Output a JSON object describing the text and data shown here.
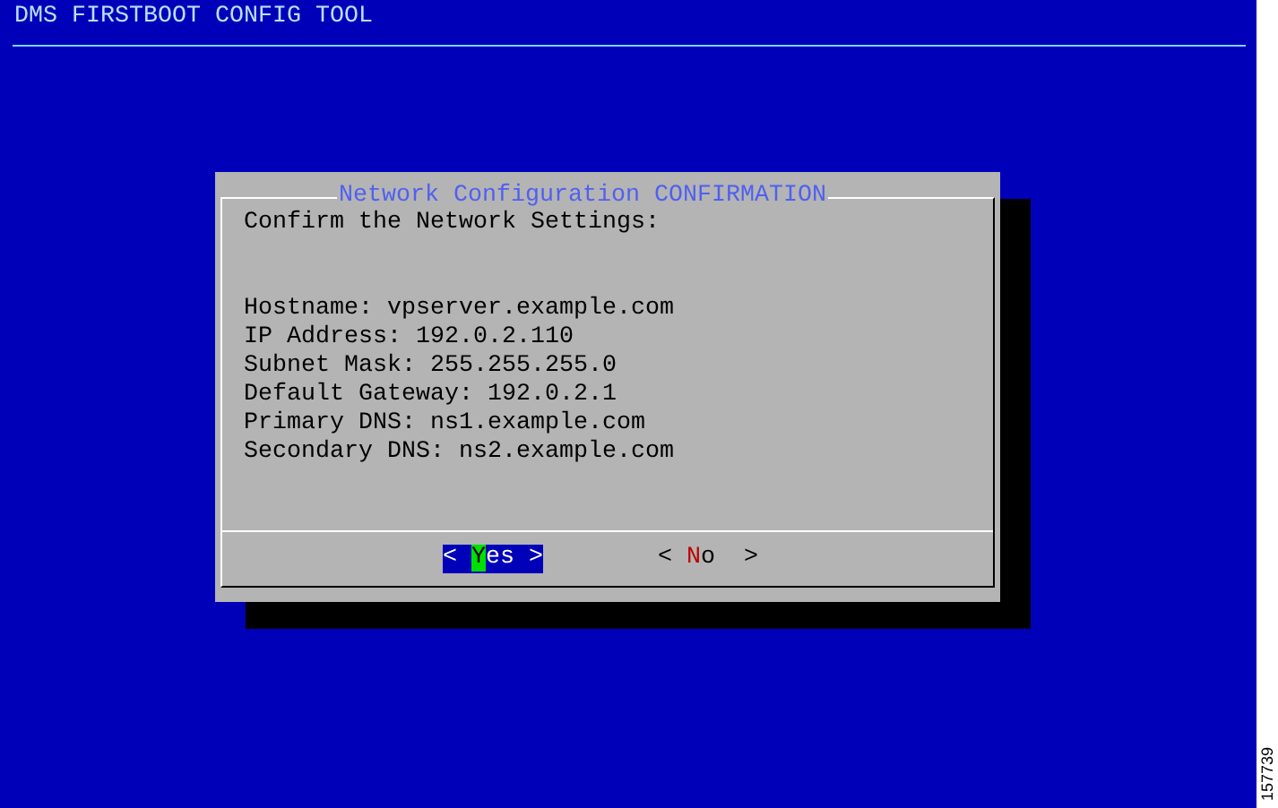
{
  "screen": {
    "title": "DMS FIRSTBOOT CONFIG TOOL"
  },
  "dialog": {
    "title": "Network Configuration CONFIRMATION",
    "prompt": "Confirm the Network Settings:",
    "settings": [
      {
        "label": "Hostname:",
        "value": "vpserver.example.com"
      },
      {
        "label": "IP Address:",
        "value": "192.0.2.110"
      },
      {
        "label": "Subnet Mask:",
        "value": "255.255.255.0"
      },
      {
        "label": "Default Gateway:",
        "value": "192.0.2.1"
      },
      {
        "label": "Primary DNS:",
        "value": "ns1.example.com"
      },
      {
        "label": "Secondary DNS:",
        "value": "ns2.example.com"
      }
    ],
    "buttons": [
      {
        "open": "<",
        "label": "Yes",
        "close": ">",
        "selected": true
      },
      {
        "open": "<",
        "label": "No",
        "close": ">",
        "selected": false
      }
    ]
  },
  "figure_number": "157739"
}
